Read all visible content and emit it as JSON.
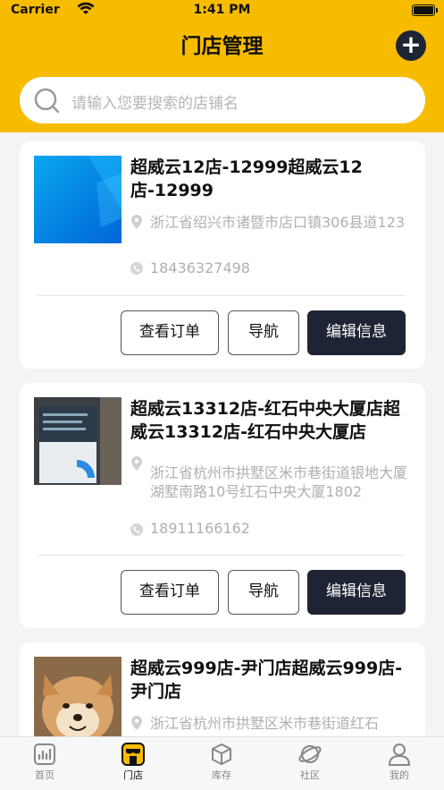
{
  "status_bar": {
    "carrier": "Carrier",
    "time": "1:41 PM"
  },
  "nav": {
    "title": "门店管理",
    "add_label": "+"
  },
  "search": {
    "placeholder": "请输入您要搜索的店铺名"
  },
  "stores": [
    {
      "name": "超威云12店-12999超威云12店-12999",
      "address": "浙江省绍兴市诸暨市店口镇306县道123",
      "phone": "18436327498",
      "buttons": [
        "查看订单",
        "导航",
        "编辑信息"
      ]
    },
    {
      "name": "超威云13312店-红石中央大厦店超威云13312店-红石中央大厦店",
      "address": "浙江省杭州市拱墅区米市巷街道银地大厦湖墅南路10号红石中央大厦1802",
      "phone": "18911166162",
      "buttons": [
        "查看订单",
        "导航",
        "编辑信息"
      ]
    },
    {
      "name": "超威云999店-尹门店超威云999店-尹门店",
      "address": "浙江省杭州市拱墅区米市巷街道红石"
    }
  ],
  "tabbar": {
    "items": [
      {
        "label": "首页",
        "icon": "chart-icon"
      },
      {
        "label": "门店",
        "icon": "store-icon",
        "active": true
      },
      {
        "label": "库存",
        "icon": "cube-icon"
      },
      {
        "label": "社区",
        "icon": "planet-icon"
      },
      {
        "label": "我的",
        "icon": "user-icon"
      }
    ]
  },
  "colors": {
    "brand": "#f7bb00",
    "dark": "#1e2433"
  }
}
